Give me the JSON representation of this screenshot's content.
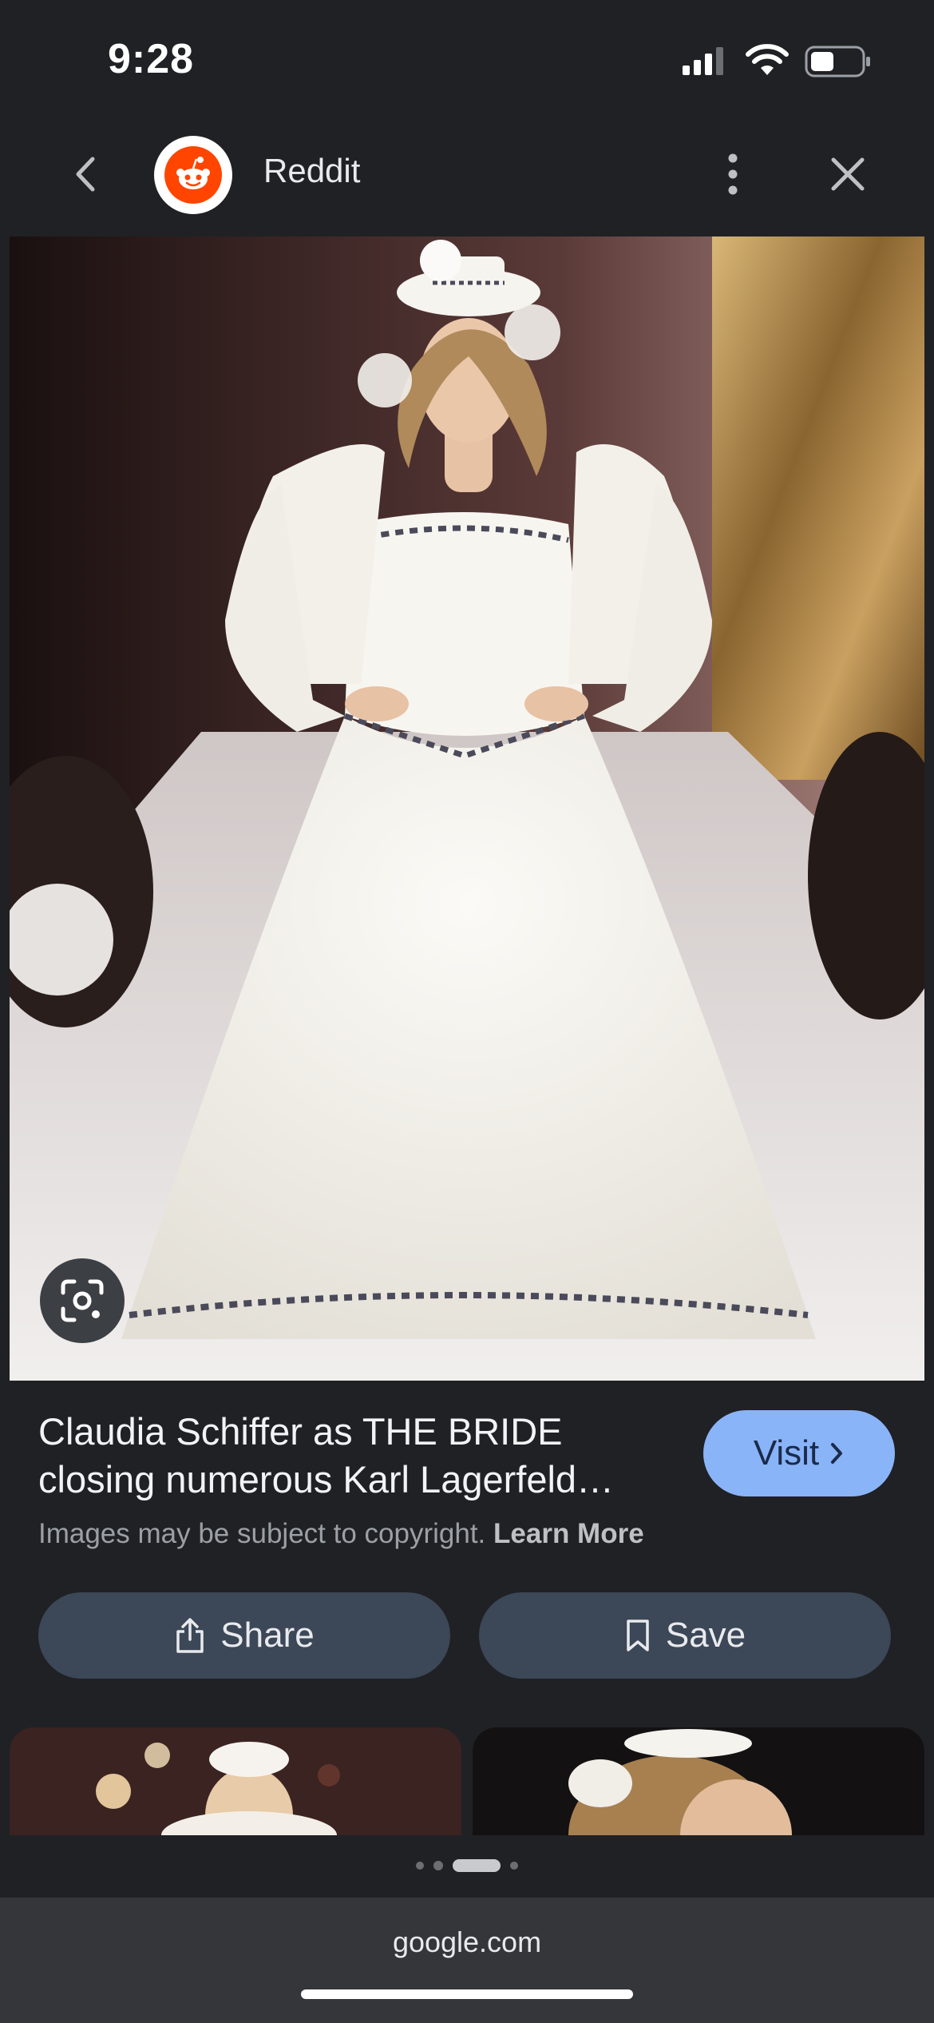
{
  "status_bar": {
    "time": "9:28"
  },
  "header": {
    "site_name": "Reddit",
    "icons": {
      "back": "chevron-left-icon",
      "site_logo": "reddit-logo-icon",
      "more": "more-vertical-icon",
      "close": "close-icon"
    }
  },
  "image": {
    "lens_icon": "google-lens-icon"
  },
  "caption": {
    "title_line1": "Claudia Schiffer as THE BRIDE",
    "title_line2": "closing numerous Karl Lagerfeld…",
    "visit_label": "Visit",
    "copyright_text": "Images may be subject to copyright.",
    "learn_more": "Learn More"
  },
  "actions": {
    "share_label": "Share",
    "save_label": "Save"
  },
  "pagination": {
    "total": 4,
    "active": 3
  },
  "url_bar": {
    "url": "google.com"
  },
  "colors": {
    "background": "#202124",
    "accent": "#8ab4f8",
    "button_bg": "#3c4757",
    "reddit_orange": "#ff4500"
  }
}
